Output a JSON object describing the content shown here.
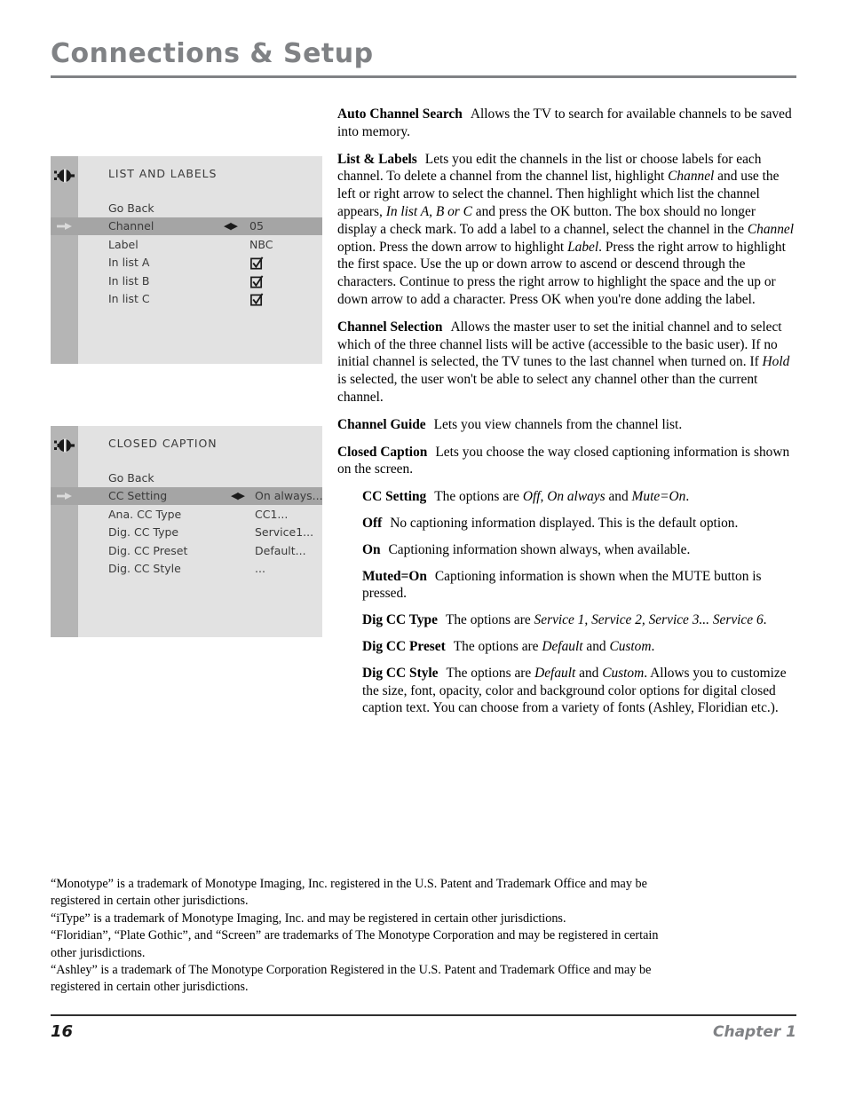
{
  "header": {
    "title": "Connections & Setup"
  },
  "menus": [
    {
      "id": "list-and-labels",
      "heading": "LIST AND LABELS",
      "icon": "connector-plug-icon",
      "cursor_row_index": 1,
      "rows": [
        {
          "label": "Go Back",
          "value": "",
          "type": "text",
          "arrows": ""
        },
        {
          "label": "Channel",
          "value": "05",
          "type": "text",
          "arrows": "◀▶"
        },
        {
          "label": "Label",
          "value": "NBC",
          "type": "text",
          "arrows": ""
        },
        {
          "label": "In list A",
          "value": "checked",
          "type": "checkbox",
          "arrows": ""
        },
        {
          "label": "In list B",
          "value": "checked",
          "type": "checkbox",
          "arrows": ""
        },
        {
          "label": "In list C",
          "value": "checked",
          "type": "checkbox",
          "arrows": ""
        }
      ]
    },
    {
      "id": "closed-caption",
      "heading": "CLOSED CAPTION",
      "icon": "connector-plug-icon",
      "cursor_row_index": 1,
      "rows": [
        {
          "label": "Go Back",
          "value": "",
          "type": "text",
          "arrows": ""
        },
        {
          "label": "CC Setting",
          "value": "On always...",
          "type": "text",
          "arrows": "◀▶"
        },
        {
          "label": "Ana. CC Type",
          "value": "CC1...",
          "type": "text",
          "arrows": ""
        },
        {
          "label": "Dig. CC Type",
          "value": "Service1...",
          "type": "text",
          "arrows": ""
        },
        {
          "label": "Dig. CC Preset",
          "value": "Default...",
          "type": "text",
          "arrows": ""
        },
        {
          "label": "Dig. CC Style",
          "value": "...",
          "type": "text",
          "arrows": ""
        }
      ]
    }
  ],
  "body": {
    "auto_channel_search": {
      "term": "Auto Channel Search",
      "text": "Allows the TV to search for available channels to be saved into memory."
    },
    "list_and_labels": {
      "term": "List & Labels",
      "t1": "Lets you edit the channels in the list or choose labels for each channel. To delete a channel from the channel list, highlight ",
      "i1": "Channel",
      "t2": " and use the left or right arrow to select the channel. Then highlight which list the channel appears, ",
      "i2": "In list A, B or C",
      "t3": " and press the OK button. The box should no longer display a check mark. To add a label to a channel, select the channel in the ",
      "i3": "Channel",
      "t4": " option. Press the down arrow to highlight ",
      "i4": "Label",
      "t5": ". Press the right arrow to highlight the first space. Use the up or down arrow to ascend or descend through the characters. Continue to press the right arrow to highlight the space and the up or down arrow to add a character. Press OK when you're done adding the label."
    },
    "channel_selection": {
      "term": "Channel Selection",
      "t1": "Allows the master user to set the initial channel and to select which of the three channel lists will be active (accessible to the basic user). If no initial channel is selected, the TV tunes to the last channel when turned on. If ",
      "i1": "Hold",
      "t2": " is selected, the user won't be able to select any channel other than the current channel."
    },
    "channel_guide": {
      "term": "Channel Guide",
      "text": "Lets you view channels from the channel list."
    },
    "closed_caption": {
      "term": "Closed Caption",
      "text": "Lets you choose the way closed captioning information is shown on the screen."
    },
    "cc_setting": {
      "term": "CC Setting",
      "t1": "The options are ",
      "i1": "Off, On always",
      "t2": " and ",
      "i2": "Mute=On",
      "t3": "."
    },
    "cc_off": {
      "term": "Off",
      "text": "No captioning information displayed. This is the default option."
    },
    "cc_on": {
      "term": "On",
      "text": "Captioning information shown always, when available."
    },
    "cc_muted_on": {
      "term": "Muted=On",
      "text": "Captioning information is shown when the MUTE button is pressed."
    },
    "dig_cc_type": {
      "term": "Dig CC Type",
      "t1": "The options are ",
      "i1": "Service 1, Service 2, Service 3... Service 6",
      "t2": "."
    },
    "dig_cc_preset": {
      "term": "Dig CC Preset",
      "t1": "The options are ",
      "i1": "Default",
      "t2": " and ",
      "i2": "Custom",
      "t3": "."
    },
    "dig_cc_style": {
      "term": "Dig CC Style",
      "t1": "The options are ",
      "i1": "Default",
      "t2": " and ",
      "i2": "Custom",
      "t3": ". Allows you to customize the size, font, opacity, color and background color options for digital closed caption text. You can choose from a variety of fonts (Ashley, Floridian etc.)."
    }
  },
  "trademarks": {
    "line1": "“Monotype” is a trademark of Monotype Imaging, Inc. registered in the U.S. Patent and Trademark Office and may be registered in certain other jurisdictions.",
    "line2": "“iType” is a trademark of Monotype Imaging, Inc. and may be registered in certain other jurisdictions.",
    "line3": "“Floridian”, “Plate Gothic”, and “Screen” are trademarks of The Monotype Corporation and may be registered in certain other jurisdictions.",
    "line4": "“Ashley” is a trademark of The Monotype Corporation Registered in the U.S. Patent and Trademark Office and may be registered in certain other jurisdictions."
  },
  "footer": {
    "page_number": "16",
    "chapter": "Chapter 1"
  },
  "colors": {
    "title_gray": "#808285",
    "panel_bg": "#e2e2e2",
    "panel_rail": "#b5b5b5",
    "panel_highlight": "#a5a5a5"
  }
}
